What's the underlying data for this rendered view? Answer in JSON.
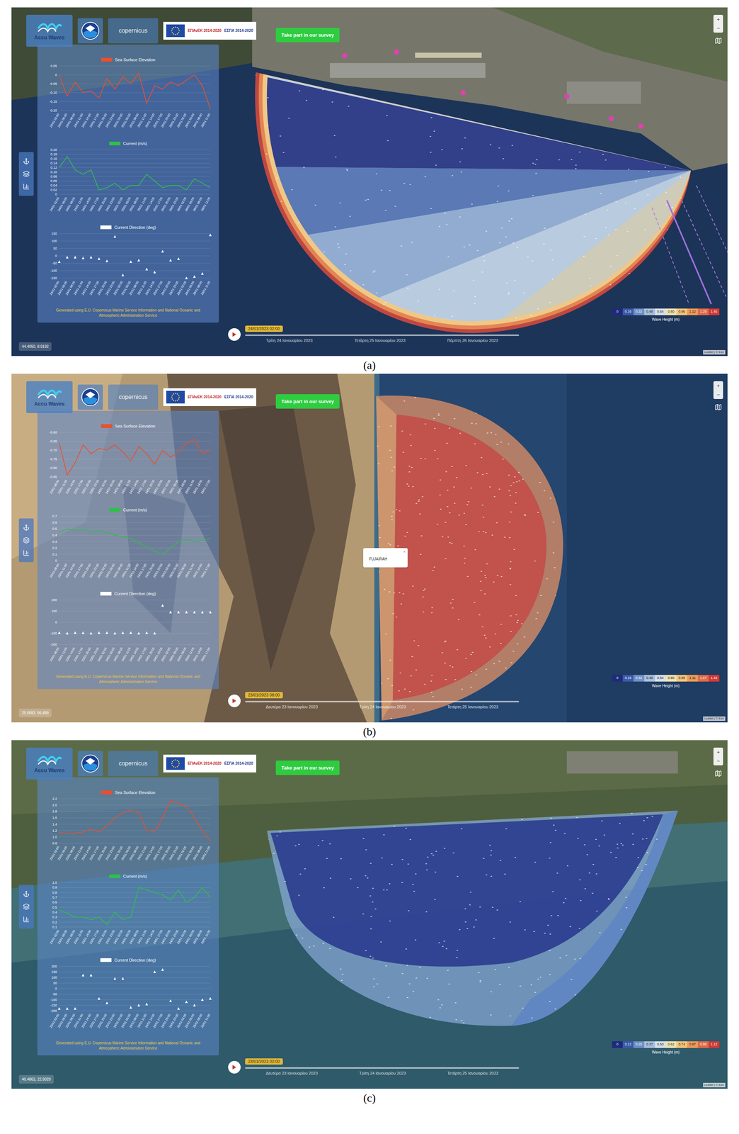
{
  "figure": {
    "brand": "Accu Waves",
    "copernicus": "copernicus",
    "epanek": "ΕΠΑνΕΚ 2014-2020",
    "espa": "ΕΣΠΑ 2014-2020",
    "survey_button": "Take part in our survey",
    "zoom": [
      "+",
      "−"
    ],
    "attribution": "Leaflet | © Esri"
  },
  "panels": [
    {
      "label": "(a)",
      "charts": [
        {
          "title": "Sea Surface Elevation",
          "kind": "line",
          "color": "#e8502e",
          "y_ticks": [
            "0.05",
            "0",
            "-0.05",
            "-0.10",
            "-0.15",
            "-0.20"
          ],
          "values": [
            0,
            -0.12,
            -0.04,
            -0.1,
            -0.09,
            -0.13,
            -0.02,
            -0.08,
            -0.01,
            -0.05,
            0.01,
            -0.16,
            -0.06,
            -0.08,
            -0.04,
            -0.06,
            -0.03,
            0,
            -0.06,
            -0.19
          ]
        },
        {
          "title": "Current (m/s)",
          "kind": "line",
          "color": "#2fbf4a",
          "y_ticks": [
            "0.20",
            "0.18",
            "0.16",
            "0.14",
            "0.12",
            "0.10",
            "0.08",
            "0.06",
            "0.04",
            "0.02",
            "0"
          ],
          "values": [
            0.12,
            0.17,
            0.11,
            0.09,
            0.11,
            0.02,
            0.03,
            0.05,
            0.02,
            0.04,
            0.04,
            0.09,
            0.06,
            0.03,
            0.04,
            0.04,
            0.02,
            0.07,
            0.05,
            0.03
          ]
        },
        {
          "title": "Current Direction (deg)",
          "kind": "arrows",
          "color": "#ffffff",
          "y_ticks": [
            "150",
            "100",
            "50",
            "0",
            "-50",
            "-100",
            "-150"
          ],
          "values": [
            -40,
            -10,
            -10,
            -15,
            -10,
            -20,
            -35,
            130,
            -130,
            -40,
            -30,
            -90,
            -110,
            30,
            -30,
            -20,
            -150,
            -140,
            -120,
            140
          ]
        }
      ],
      "x_labels": [
        "24/01 02:00",
        "24/01 05:00",
        "24/01 08:00",
        "24/01 11:00",
        "24/01 14:00",
        "24/01 17:00",
        "24/01 20:00",
        "24/01 23:00",
        "25/01 02:00",
        "25/01 05:00",
        "25/01 08:00",
        "25/01 11:00",
        "25/01 14:00",
        "25/01 17:00",
        "25/01 20:00",
        "25/01 23:00",
        "26/01 02:00",
        "26/01 05:00",
        "26/01 08:00",
        "26/01 11:00"
      ],
      "footer": "Generated using E.U. Copernicus Marine Service Information and National Oceanic and Atmospheric Administration Service",
      "timeline": {
        "current": "24/01/2023 02:00",
        "level": 0.0,
        "dates": [
          "Τρίτη 24 Ιανουαρίου 2023",
          "Τετάρτη 25 Ιανουαρίου 2023",
          "Πέμπτη 26 Ιανουαρίου 2023"
        ]
      },
      "legend": {
        "title": "Wave Height (m)",
        "ticks": [
          "0",
          "0.16",
          "0.32",
          "0.48",
          "0.64",
          "0.80",
          "0.96",
          "1.12",
          "1.29",
          "1.45"
        ],
        "colors": [
          "#1f2a7c",
          "#3a5aa8",
          "#6f8fc6",
          "#a7bfdc",
          "#d6dfe6",
          "#efe2b0",
          "#f3c47a",
          "#ec9a58",
          "#e06a48",
          "#d13a36"
        ]
      },
      "coordinates": "44.4050, 8.9192",
      "popup": null
    },
    {
      "label": "(b)",
      "charts": [
        {
          "title": "Sea Surface Elevation",
          "kind": "line",
          "color": "#e8502e",
          "y_ticks": [
            "-0.60",
            "-0.65",
            "-0.70",
            "-0.75",
            "-0.80",
            "-0.85"
          ],
          "values": [
            -0.66,
            -0.84,
            -0.77,
            -0.67,
            -0.72,
            -0.69,
            -0.7,
            -0.67,
            -0.71,
            -0.76,
            -0.68,
            -0.72,
            -0.78,
            -0.7,
            -0.74,
            -0.71,
            -0.66,
            -0.64,
            -0.72,
            -0.7
          ]
        },
        {
          "title": "Current (m/s)",
          "kind": "line",
          "color": "#2fbf4a",
          "y_ticks": [
            "0.7",
            "0.6",
            "0.5",
            "0.4",
            "0.3",
            "0.2",
            "0.1",
            "0"
          ],
          "values": [
            0.45,
            0.5,
            0.47,
            0.5,
            0.45,
            0.47,
            0.44,
            0.4,
            0.38,
            0.35,
            0.28,
            0.22,
            0.15,
            0.1,
            0.2,
            0.3,
            0.33,
            0.3,
            0.32,
            0.35
          ]
        },
        {
          "title": "Current Direction (deg)",
          "kind": "arrows",
          "color": "#ffffff",
          "y_ticks": [
            "200",
            "100",
            "0",
            "-100",
            "-200"
          ],
          "values": [
            -95,
            -100,
            -95,
            -95,
            -100,
            -95,
            -95,
            -100,
            -95,
            -95,
            -100,
            -95,
            -100,
            150,
            90,
            90,
            90,
            90,
            90,
            90
          ]
        }
      ],
      "x_labels": [
        "23/01 08:00",
        "23/01 11:00",
        "23/01 14:00",
        "23/01 17:00",
        "23/01 20:00",
        "23/01 23:00",
        "24/01 02:00",
        "24/01 05:00",
        "24/01 08:00",
        "24/01 11:00",
        "24/01 14:00",
        "24/01 17:00",
        "24/01 20:00",
        "24/01 23:00",
        "25/01 02:00",
        "25/01 05:00",
        "25/01 08:00",
        "25/01 11:00",
        "25/01 14:00",
        "25/01 17:00"
      ],
      "footer": "Generated using E.U. Copernicus Marine Service Information and National Oceanic and Atmospheric Administration Service",
      "timeline": {
        "current": "23/01/2023 08:00",
        "level": 0.0,
        "dates": [
          "Δευτέρα 23 Ιανουαρίου 2023",
          "Τρίτη 24 Ιανουαρίου 2023",
          "Τετάρτη 25 Ιανουαρίου 2023"
        ]
      },
      "legend": {
        "title": "Wave Height (m)",
        "ticks": [
          "0",
          "0.16",
          "0.32",
          "0.48",
          "0.64",
          "0.80",
          "0.95",
          "1.11",
          "1.27",
          "1.43"
        ],
        "colors": [
          "#1f2a7c",
          "#3a5aa8",
          "#6f8fc6",
          "#a7bfdc",
          "#d6dfe6",
          "#efe2b0",
          "#f3c47a",
          "#ec9a58",
          "#e06a48",
          "#d13a36"
        ]
      },
      "coordinates": "25.0083, 56.489",
      "popup": {
        "text": "FUJAIRAH",
        "close": "×"
      }
    },
    {
      "label": "(c)",
      "charts": [
        {
          "title": "Sea Surface Elevation",
          "kind": "line",
          "color": "#e8502e",
          "y_ticks": [
            "2.2",
            "2.0",
            "1.8",
            "1.6",
            "1.4",
            "1.2",
            "1.0",
            "0.8"
          ],
          "values": [
            1.15,
            1.1,
            1.12,
            1.15,
            1.25,
            1.15,
            1.35,
            1.6,
            1.75,
            1.85,
            1.75,
            1.2,
            1.15,
            1.6,
            2.15,
            2.05,
            1.95,
            1.6,
            1.2,
            0.85
          ]
        },
        {
          "title": "Current (m/s)",
          "kind": "line",
          "color": "#2fbf4a",
          "y_ticks": [
            "1.0",
            "0.9",
            "0.8",
            "0.7",
            "0.6",
            "0.5",
            "0.4",
            "0.3",
            "0.2",
            "0.1"
          ],
          "values": [
            0.45,
            0.38,
            0.3,
            0.3,
            0.25,
            0.3,
            0.15,
            0.4,
            0.25,
            0.3,
            0.9,
            0.85,
            0.8,
            0.75,
            0.65,
            0.85,
            0.6,
            0.7,
            0.9,
            0.7
          ]
        },
        {
          "title": "Current Direction (deg)",
          "kind": "arrows",
          "color": "#ffffff",
          "y_ticks": [
            "200",
            "150",
            "100",
            "50",
            "0",
            "-50",
            "-100",
            "-150",
            "-200"
          ],
          "values": [
            -180,
            -180,
            -180,
            120,
            120,
            -90,
            -130,
            90,
            90,
            -170,
            -150,
            -140,
            150,
            170,
            -110,
            -180,
            -120,
            -150,
            -100,
            -90
          ]
        }
      ],
      "x_labels": [
        "23/01 02:00",
        "23/01 05:00",
        "23/01 08:00",
        "23/01 11:00",
        "23/01 14:00",
        "23/01 17:00",
        "23/01 20:00",
        "23/01 23:00",
        "24/01 02:00",
        "24/01 05:00",
        "24/01 08:00",
        "24/01 11:00",
        "24/01 14:00",
        "24/01 17:00",
        "24/01 20:00",
        "24/01 23:00",
        "25/01 02:00",
        "25/01 05:00",
        "25/01 08:00",
        "25/01 11:00"
      ],
      "footer": "Generated using E.U. Copernicus Marine Service Information and National Oceanic and Atmospheric Administration Service",
      "timeline": {
        "current": "23/01/2023 02:00",
        "level": 0.0,
        "dates": [
          "Δευτέρα 23 Ιανουαρίου 2023",
          "Τρίτη 24 Ιανουαρίου 2023",
          "Τετάρτη 25 Ιανουαρίου 2023"
        ]
      },
      "legend": {
        "title": "Wave Height (m)",
        "ticks": [
          "0",
          "0.12",
          "0.25",
          "0.37",
          "0.50",
          "0.62",
          "0.74",
          "0.87",
          "0.99",
          "1.12"
        ],
        "colors": [
          "#1f2a7c",
          "#3a5aa8",
          "#6f8fc6",
          "#a7bfdc",
          "#d6dfe6",
          "#efe2b0",
          "#f3c47a",
          "#ec9a58",
          "#e06a48",
          "#d13a36"
        ]
      },
      "coordinates": "40.4863, 22.9029",
      "popup": null
    }
  ]
}
